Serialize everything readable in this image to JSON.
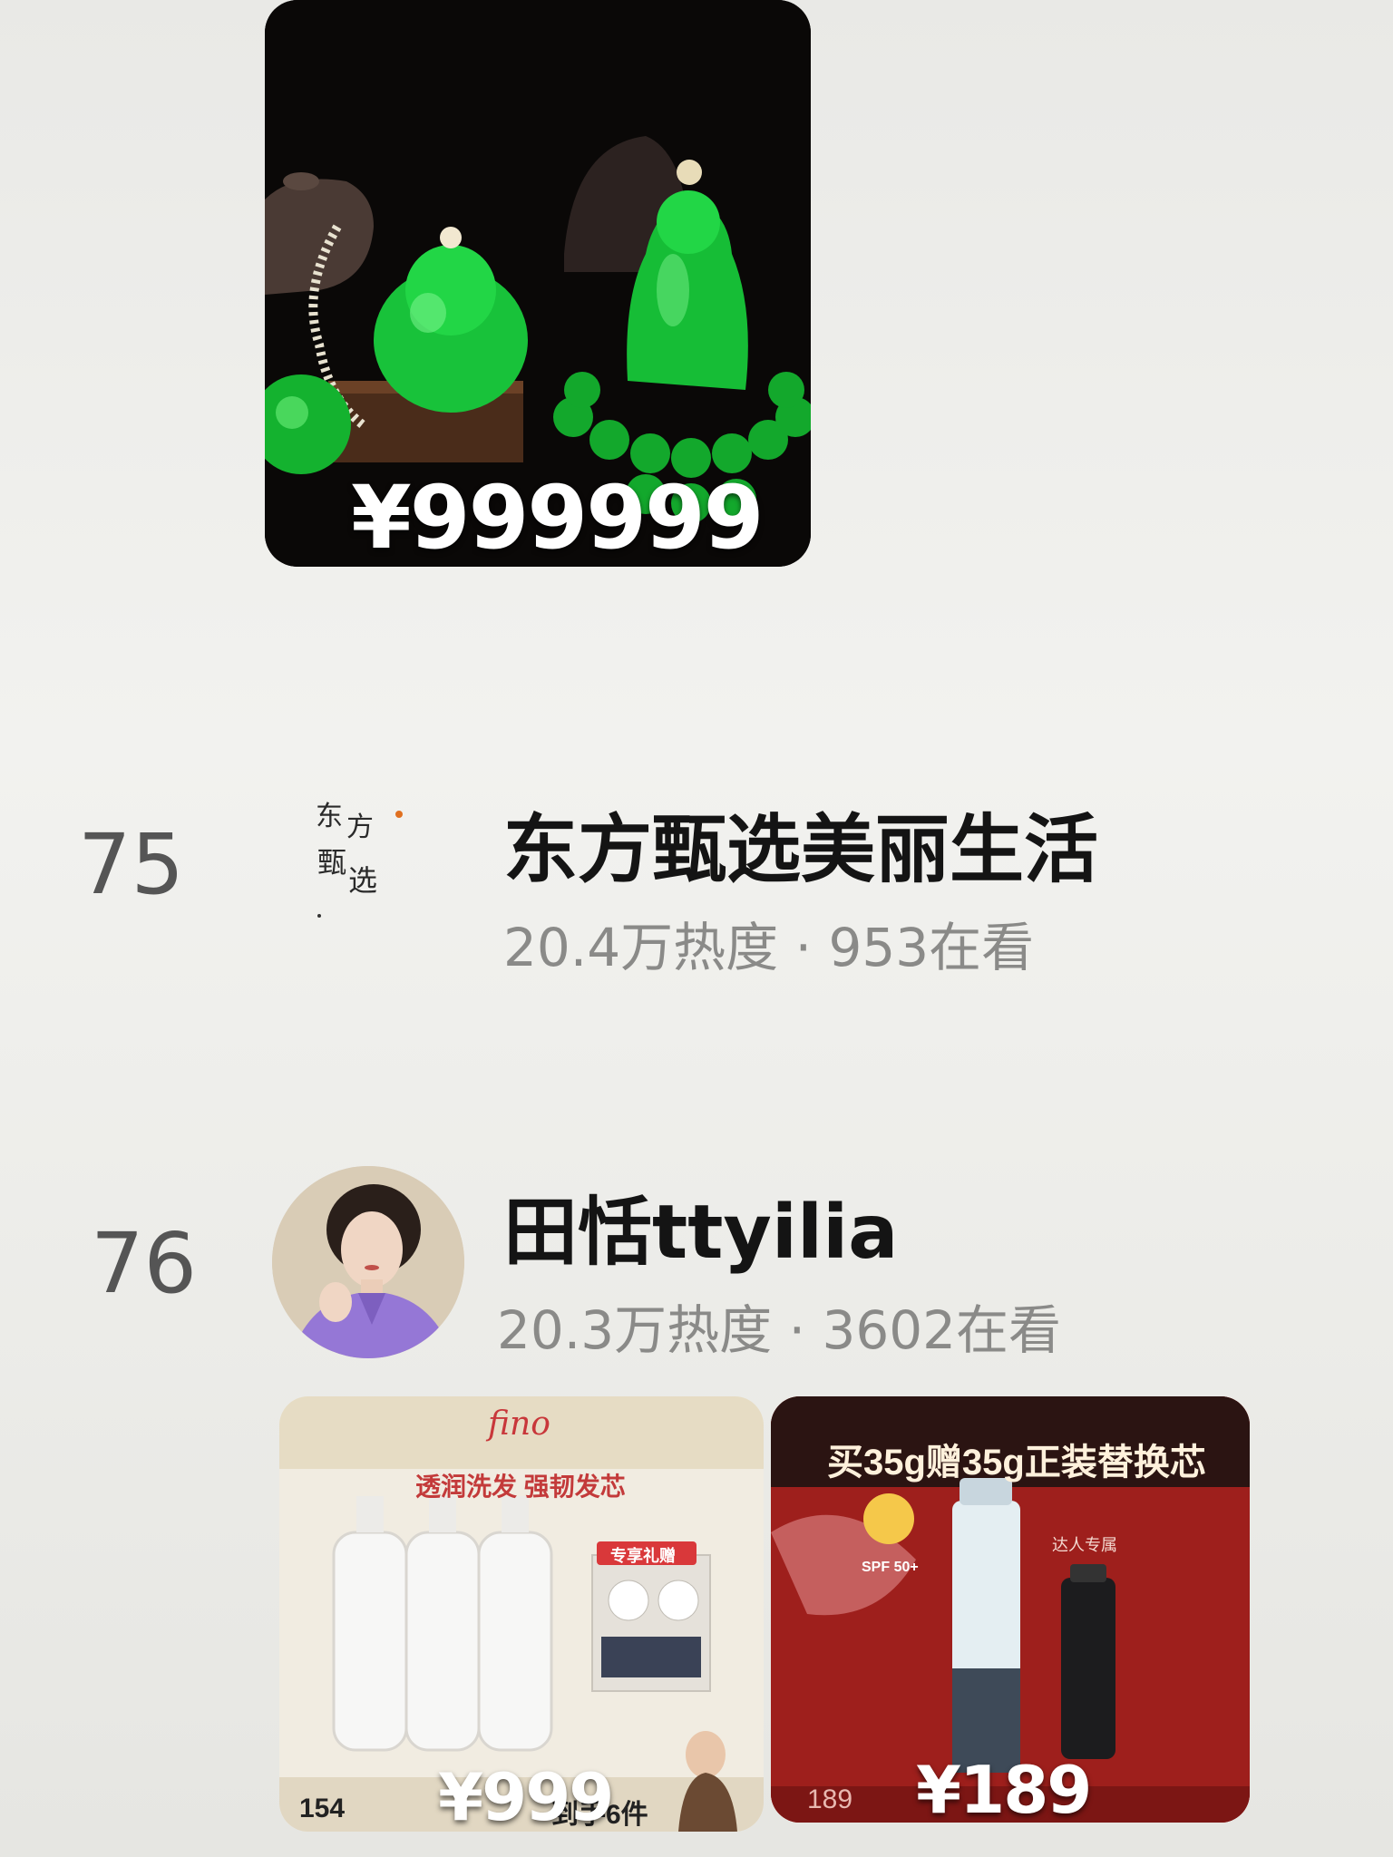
{
  "top_product": {
    "price": "¥999999"
  },
  "rows": [
    {
      "rank": "75",
      "name": "东方甄选美丽生活",
      "stats": "20.4万热度 · 953在看",
      "avatar_text": "东方甄选"
    },
    {
      "rank": "76",
      "name": "田恬ttyilia",
      "stats": "20.3万热度 · 3602在看"
    }
  ],
  "products": [
    {
      "brand": "fino",
      "headline": "透润洗发 强韧发芯",
      "gift_tag": "专享礼赠",
      "price": "¥999",
      "small_left": "154",
      "caption": "到手6件"
    },
    {
      "headline": "买35g赠35g正装替换芯",
      "badge": "SPF 50+",
      "side_label": "达人专属",
      "price": "¥189",
      "small_left": "189"
    }
  ],
  "colors": {
    "background": "#eeeeeb",
    "rank_text": "#555555",
    "stats_text": "#8a8a88",
    "jade_green": "#19c43a",
    "sun_red": "#c7312a"
  }
}
